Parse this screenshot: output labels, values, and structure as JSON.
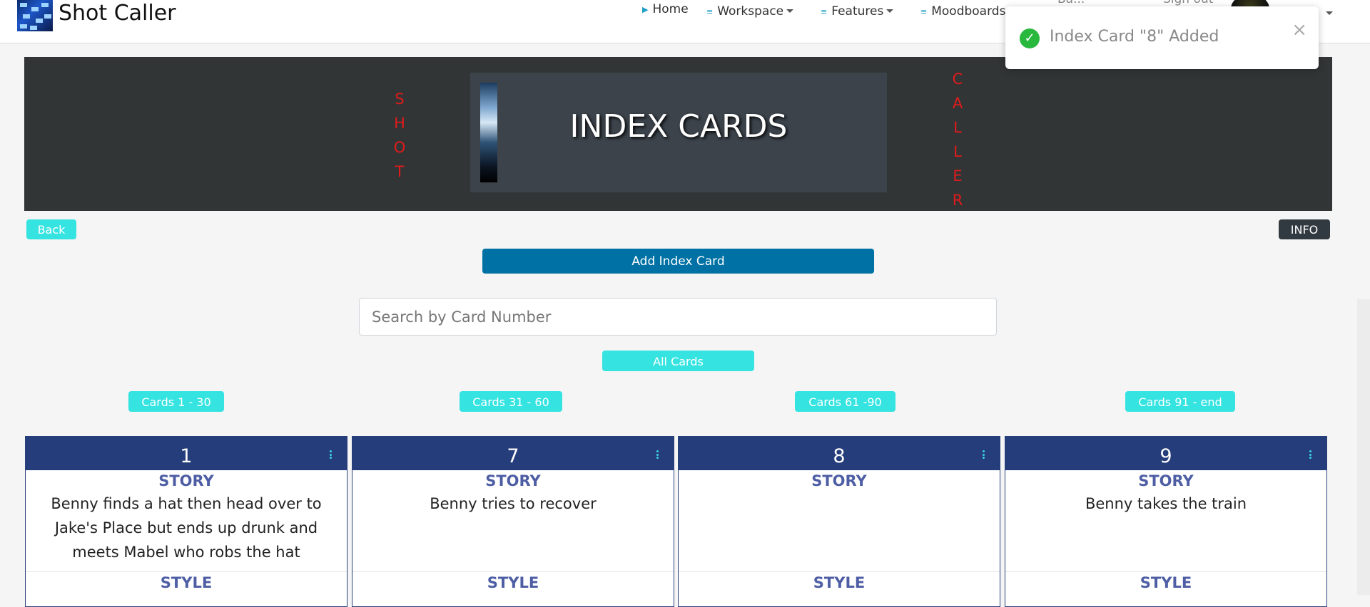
{
  "nav": {
    "brand": "Shot Caller",
    "home": "Home",
    "workspace": "Workspace",
    "features": "Features",
    "moodboards": "Moodboards",
    "partial_1": "Ba...",
    "partial_2": "Sign out"
  },
  "toast": {
    "message": "Index Card \"8\" Added",
    "close": "×",
    "check": "✓"
  },
  "hero": {
    "left_vertical": [
      "S",
      "H",
      "O",
      "T"
    ],
    "right_vertical": [
      "C",
      "A",
      "L",
      "L",
      "E",
      "R"
    ],
    "title": "INDEX CARDS"
  },
  "buttons": {
    "back": "Back",
    "info": "INFO",
    "add_card": "Add Index Card",
    "all_cards": "All Cards",
    "range_1": "Cards 1 - 30",
    "range_2": "Cards 31 - 60",
    "range_3": "Cards 61 -90",
    "range_4": "Cards 91 - end"
  },
  "search": {
    "placeholder": "Search by Card Number"
  },
  "cards": [
    {
      "number": "1",
      "story_label": "STORY",
      "story": "Benny finds a hat then head over to Jake's Place but ends up drunk and meets Mabel who robs the hat",
      "style_label": "STYLE"
    },
    {
      "number": "7",
      "story_label": "STORY",
      "story": "Benny tries to recover",
      "style_label": "STYLE"
    },
    {
      "number": "8",
      "story_label": "STORY",
      "story": "",
      "style_label": "STYLE"
    },
    {
      "number": "9",
      "story_label": "STORY",
      "story": "Benny takes the train",
      "style_label": "STYLE"
    }
  ],
  "colors": {
    "accent_cyan": "#35e3e1",
    "primary_blue": "#0071a4",
    "card_header": "#253d7b",
    "hero_bg": "#323536",
    "vertical_text": "#e01b1b",
    "success": "#29b83e"
  }
}
